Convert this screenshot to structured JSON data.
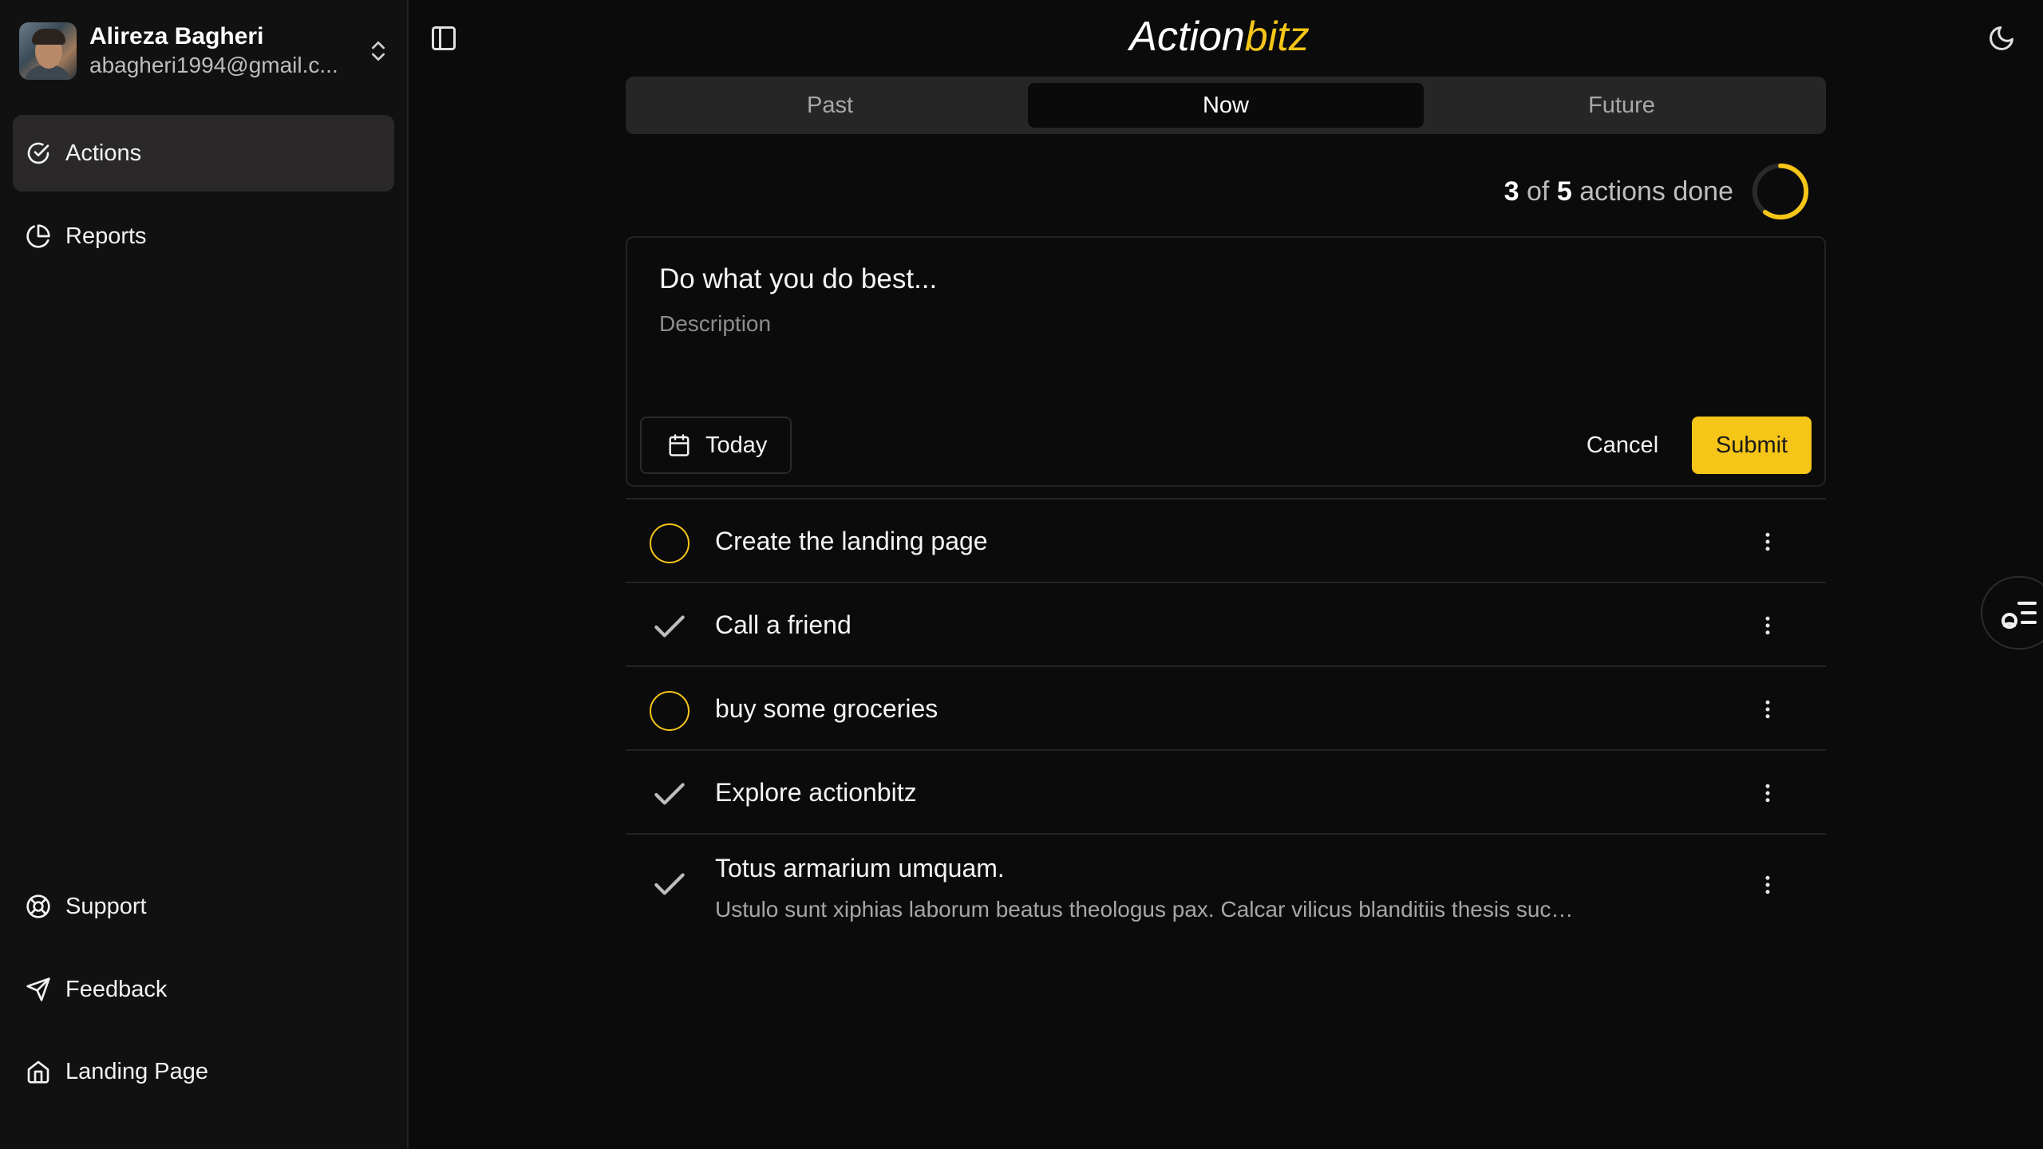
{
  "user": {
    "name": "Alireza Bagheri",
    "email": "abagheri1994@gmail.c..."
  },
  "sidebar": {
    "main_items": [
      {
        "label": "Actions",
        "active": true
      },
      {
        "label": "Reports"
      }
    ],
    "bottom_items": [
      {
        "label": "Support"
      },
      {
        "label": "Feedback"
      },
      {
        "label": "Landing Page"
      }
    ]
  },
  "header": {
    "logo_part1": "Action",
    "logo_part2": "bitz"
  },
  "tabs": [
    {
      "label": "Past"
    },
    {
      "label": "Now",
      "active": true
    },
    {
      "label": "Future"
    }
  ],
  "progress": {
    "done": "3",
    "of": "of",
    "total": "5",
    "suffix": "actions done",
    "fraction": 0.6
  },
  "compose": {
    "title_placeholder": "Do what you do best...",
    "description_placeholder": "Description",
    "date_label": "Today",
    "cancel_label": "Cancel",
    "submit_label": "Submit"
  },
  "actions": [
    {
      "title": "Create the landing page",
      "done": false
    },
    {
      "title": "Call a friend",
      "done": true
    },
    {
      "title": "buy some groceries",
      "done": false
    },
    {
      "title": "Explore actionbitz",
      "done": true
    },
    {
      "title": "Totus armarium umquam.",
      "description": "Ustulo sunt xiphias laborum beatus theologus pax. Calcar vilicus blanditiis thesis succurro baiulus tabula",
      "done": true
    }
  ],
  "colors": {
    "accent": "#f5c518",
    "background": "#0b0b0b",
    "sidebar": "#111111"
  }
}
